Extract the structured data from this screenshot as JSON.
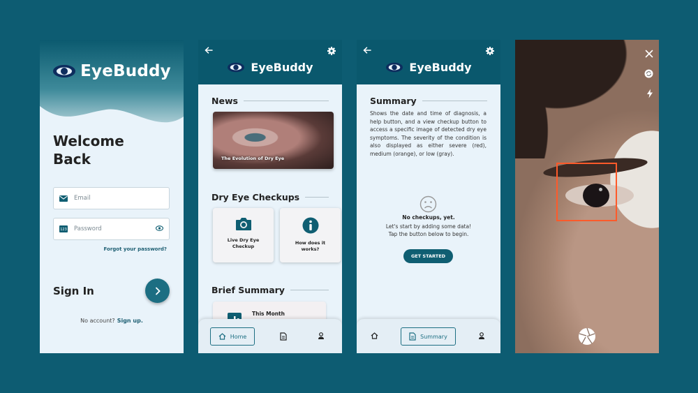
{
  "colors": {
    "background": "#0d5c72",
    "app_bar": "#0a586d",
    "accent": "#1c6e82",
    "screen_bg": "#e9f3fa",
    "detection_box": "#ff5a2a"
  },
  "login": {
    "brand": "EyeBuddy",
    "welcome_line1": "Welcome",
    "welcome_line2": "Back",
    "email_placeholder": "Email",
    "password_placeholder": "Password",
    "forgot": "Forgot your password?",
    "signin": "Sign In",
    "no_account": "No account?",
    "signup": "Sign up."
  },
  "home": {
    "brand": "EyeBuddy",
    "news_title": "News",
    "news_caption": "The Evolution of Dry Eye",
    "checkups_title": "Dry Eye Checkups",
    "card_live": "Live Dry Eye Checkup",
    "card_how": "How does it works?",
    "brief_title": "Brief Summary",
    "brief_item": "This Month",
    "nav_home": "Home"
  },
  "summary": {
    "brand": "EyeBuddy",
    "title": "Summary",
    "description": "Shows the date and time of diagnosis, a help button, and a view checkup button to access a specific image of detected dry eye symptoms. The severity of the condition is also displayed as either severe (red), medium (orange), or low (gray).",
    "empty_title": "No checkups, yet.",
    "empty_line1": "Let's start by adding some data!",
    "empty_line2": "Tap the button below to begin.",
    "get_started": "GET STARTED",
    "nav_summary": "Summary"
  },
  "icons": {
    "logo": "eye-logo-icon",
    "back": "back-arrow-icon",
    "settings": "gear-icon",
    "email": "mail-icon",
    "password": "numeric-123-icon",
    "show_password": "eye-icon",
    "next": "chevron-right-icon",
    "camera": "camera-icon",
    "info": "info-icon",
    "chart": "bar-chart-icon",
    "home": "home-icon",
    "document": "document-icon",
    "profile": "person-icon",
    "sad": "sad-face-icon",
    "close": "close-icon",
    "flip": "flip-camera-icon",
    "flash": "flash-icon",
    "shutter": "shutter-icon"
  }
}
